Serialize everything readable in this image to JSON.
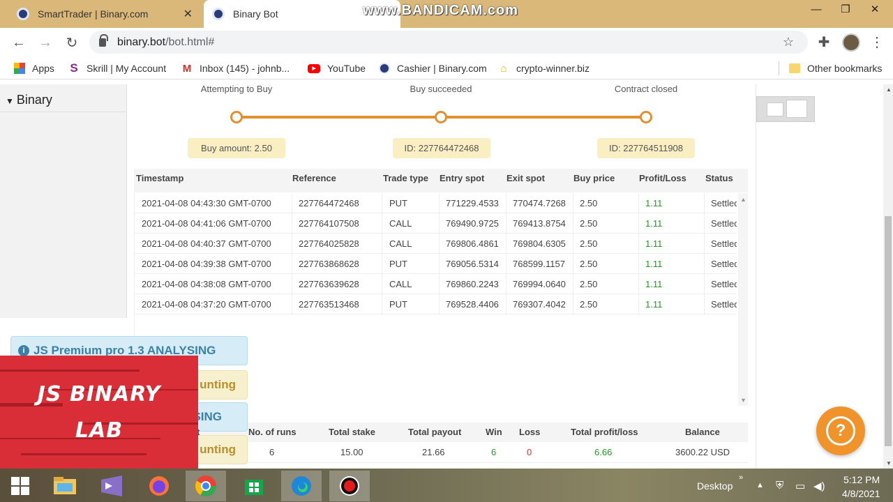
{
  "browser": {
    "tabs": [
      {
        "title": "SmartTrader | Binary.com",
        "active": false
      },
      {
        "title": "Binary Bot",
        "active": true
      }
    ],
    "watermark": "www.BANDICAM.com",
    "url_host": "binary.bot",
    "url_path": "/bot.html#",
    "bookmarks": [
      {
        "label": "Apps",
        "icon": "apps-grid-icon"
      },
      {
        "label": "Skrill | My Account",
        "icon": "skrill-icon"
      },
      {
        "label": "Inbox (145) - johnb...",
        "icon": "gmail-icon"
      },
      {
        "label": "YouTube",
        "icon": "youtube-icon"
      },
      {
        "label": "Cashier | Binary.com",
        "icon": "binary-icon"
      },
      {
        "label": "crypto-winner.biz",
        "icon": "crypto-icon"
      }
    ],
    "other_bookmarks": "Other bookmarks"
  },
  "sidebar": {
    "title": "Binary"
  },
  "progress": {
    "steps": [
      {
        "label": "Attempting to Buy",
        "info": "Buy amount: 2.50"
      },
      {
        "label": "Buy succeeded",
        "info": "ID: 227764472468"
      },
      {
        "label": "Contract closed",
        "info": "ID: 227764511908"
      }
    ],
    "color": "#e3902e"
  },
  "table": {
    "headers": [
      "Timestamp",
      "Reference",
      "Trade type",
      "Entry spot",
      "Exit spot",
      "Buy price",
      "Profit/Loss",
      "Status"
    ],
    "rows": [
      [
        "2021-04-08 04:43:30 GMT-0700",
        "227764472468",
        "PUT",
        "771229.4533",
        "770474.7268",
        "2.50",
        "1.11",
        "Settled"
      ],
      [
        "2021-04-08 04:41:06 GMT-0700",
        "227764107508",
        "CALL",
        "769490.9725",
        "769413.8754",
        "2.50",
        "1.11",
        "Settled"
      ],
      [
        "2021-04-08 04:40:37 GMT-0700",
        "227764025828",
        "CALL",
        "769806.4861",
        "769804.6305",
        "2.50",
        "1.11",
        "Settled"
      ],
      [
        "2021-04-08 04:39:38 GMT-0700",
        "227763868628",
        "PUT",
        "769056.5314",
        "768599.1157",
        "2.50",
        "1.11",
        "Settled"
      ],
      [
        "2021-04-08 04:38:08 GMT-0700",
        "227763639628",
        "CALL",
        "769860.2243",
        "769994.0640",
        "2.50",
        "1.11",
        "Settled"
      ],
      [
        "2021-04-08 04:37:20 GMT-0700",
        "227763513468",
        "PUT",
        "769528.4406",
        "769307.4042",
        "2.50",
        "1.11",
        "Settled"
      ]
    ]
  },
  "summary": {
    "headers": [
      "No. of runs",
      "Total stake",
      "Total payout",
      "Win",
      "Loss",
      "Total profit/loss",
      "Balance"
    ],
    "values": [
      "6",
      "15.00",
      "21.66",
      "6",
      "0",
      "6.66",
      "3600.22 USD"
    ]
  },
  "notifications": [
    {
      "text": "JS Premium pro 1.3 ANALYSING",
      "type": "info"
    },
    {
      "text": "unting",
      "type": "warning"
    },
    {
      "text": "SING",
      "type": "info"
    },
    {
      "text": "unting",
      "type": "warning"
    }
  ],
  "summary_partial_header": "t",
  "logo": {
    "line1": "JS BINARY",
    "line2": "LAB"
  },
  "help_button": "?",
  "taskbar": {
    "desktop_label": "Desktop",
    "time": "5:12 PM",
    "date": "4/8/2021"
  },
  "colors": {
    "green": "#1a9e1a",
    "red": "#d33333",
    "accent": "#f0932b"
  }
}
